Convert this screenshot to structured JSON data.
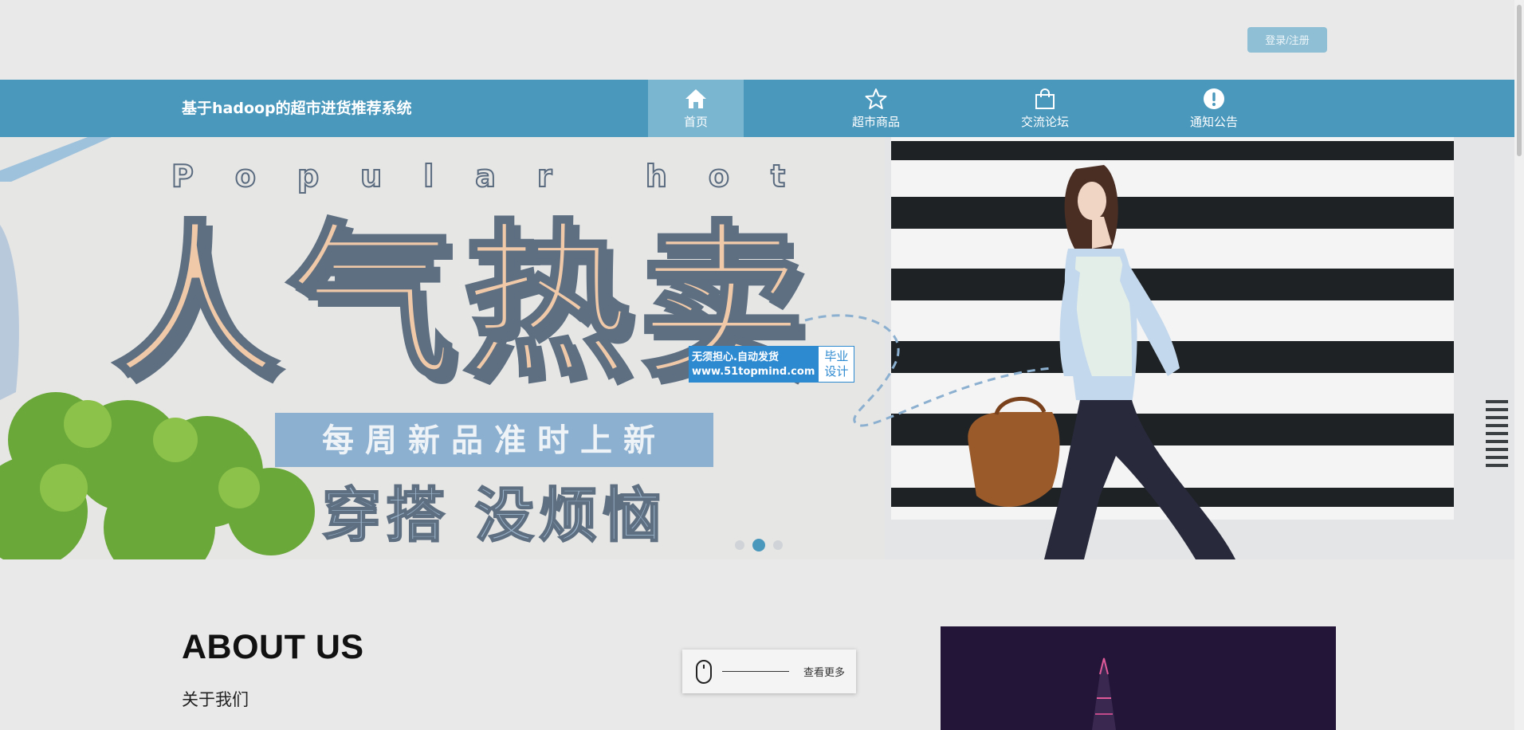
{
  "header": {
    "login_label": "登录/注册"
  },
  "nav": {
    "site_title": "基于hadoop的超市进货推荐系统",
    "items": [
      {
        "label": "首页",
        "icon": "home-icon",
        "active": true
      },
      {
        "label": "超市商品",
        "icon": "star-icon",
        "active": false
      },
      {
        "label": "交流论坛",
        "icon": "shopping-bag-icon",
        "active": false
      },
      {
        "label": "通知公告",
        "icon": "alert-icon",
        "active": false
      }
    ]
  },
  "banner": {
    "eyebrow": "Popular hot",
    "headline": "人气热卖",
    "tagline": "每周新品准时上新",
    "slogan": "穿搭 没烦恼",
    "slide_count": 3,
    "active_slide": 2
  },
  "watermark": {
    "line1": "无须担心.自动发货",
    "line2": "www.51topmind.com",
    "right_line1": "毕业",
    "right_line2": "设计"
  },
  "about": {
    "title": "ABOUT US",
    "subtitle": "关于我们",
    "more_label": "查看更多"
  },
  "colors": {
    "nav_bg": "#4a98bc",
    "nav_active": "#7ab6d0",
    "login_btn": "#8fbfd4",
    "page_bg": "#e9e9e9",
    "headline_fill": "#f0c9a8",
    "tagline_box": "#8cb0d0"
  }
}
